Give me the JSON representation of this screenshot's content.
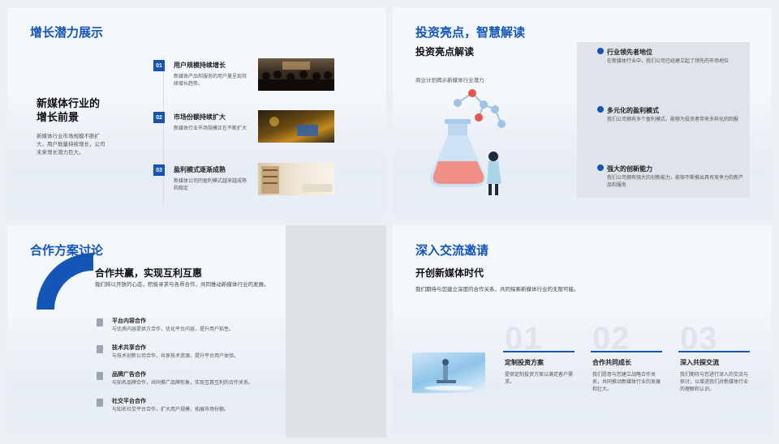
{
  "slide1": {
    "title": "增长潜力展示",
    "heading": "新媒体行业的增长前景",
    "desc": "新媒体行业市场规模不断扩大，用户数量持续增长，公司未来增长潜力巨大。",
    "items": [
      {
        "num": "01",
        "title": "用户规模持续增长",
        "desc": "新媒体产品和服务的用户量呈现持续增长趋势。"
      },
      {
        "num": "02",
        "title": "市场份额持续扩大",
        "desc": "新媒体行业市场规模正在不断扩大"
      },
      {
        "num": "03",
        "title": "盈利模式逐渐成熟",
        "desc": "新媒体公司的盈利模式越来越成熟和稳定"
      }
    ]
  },
  "slide2": {
    "title": "投资亮点，智慧解读",
    "subtitle": "投资亮点解读",
    "caption": "商业计划揭示新媒体行业潜力",
    "points": [
      {
        "title": "行业领先者地位",
        "desc": "在新媒体行业中，我们公司已经建立起了领先的市场地位"
      },
      {
        "title": "多元化的盈利模式",
        "desc": "我们公司拥有多个盈利模式，能够为投资者带来多样化的回报"
      },
      {
        "title": "强大的创新能力",
        "desc": "我们公司拥有强大的创新能力，能够不断推出具有竞争力的新产品和服务"
      }
    ]
  },
  "slide3": {
    "title": "合作方案讨论",
    "heading": "合作共赢，实现互利互惠",
    "desc": "我们将以开放的心态，积极寻求与各界合作，共同推动新媒体行业的发展。",
    "items": [
      {
        "title": "平台内容合作",
        "desc": "与优质内容提供方合作，优化平台内容，提升用户粘性。"
      },
      {
        "title": "技术共享合作",
        "desc": "与技术创新公司合作，共享技术资源，提升平台用户体验。"
      },
      {
        "title": "品牌广告合作",
        "desc": "与知名品牌合作，共同推广品牌形象，实现互惠互利的合作关系。"
      },
      {
        "title": "社交平台合作",
        "desc": "与知名社交平台合作，扩大用户规模，拓展市场份额。"
      }
    ]
  },
  "slide4": {
    "title": "深入交流邀请",
    "heading": "开创新媒体时代",
    "desc": "我们期待与您建立深度的合作关系，共同探索新媒体行业的无限可能。",
    "cols": [
      {
        "num": "01",
        "title": "定制投资方案",
        "desc": "提供定制投资方案以满足客户需求。"
      },
      {
        "num": "02",
        "title": "合作共同成长",
        "desc": "我们愿意与您建立战略合作关系，共同推动新媒体行业的发展和壮大。"
      },
      {
        "num": "03",
        "title": "深入共探交流",
        "desc": "我们期待与您进行深入的交流与探讨，以增进我们对新媒体行业的理解和认识。"
      }
    ]
  },
  "colors": {
    "accent": "#1456b8",
    "panel": "#dfe3ea"
  }
}
